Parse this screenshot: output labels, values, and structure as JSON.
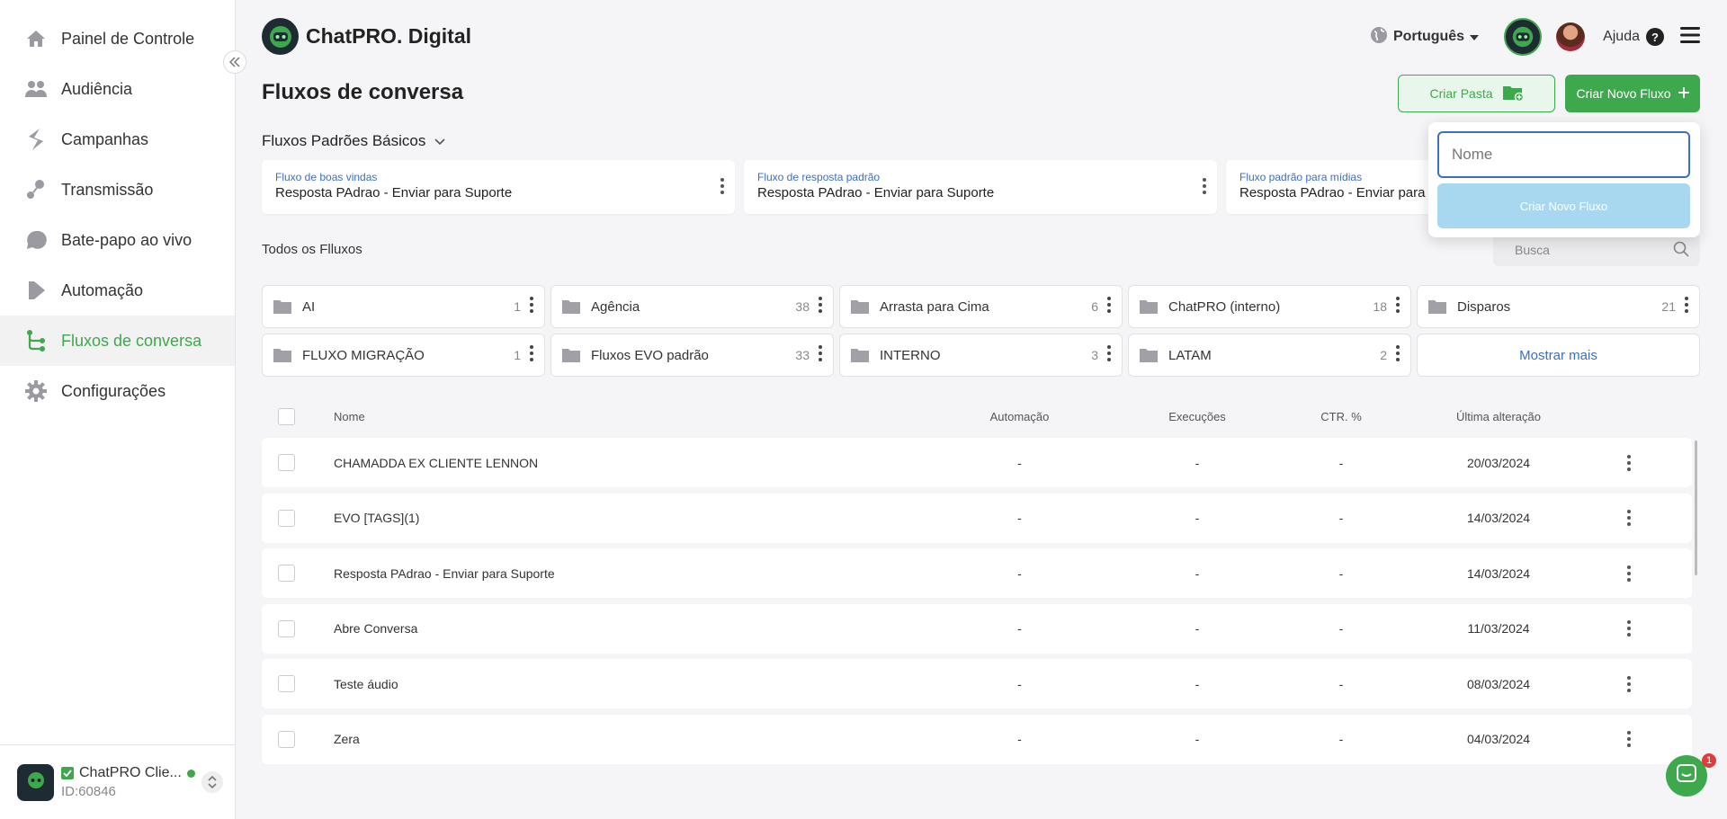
{
  "sidebar": {
    "items": [
      {
        "label": "Painel de Controle",
        "icon": "home-icon"
      },
      {
        "label": "Audiência",
        "icon": "people-icon"
      },
      {
        "label": "Campanhas",
        "icon": "campaign-icon"
      },
      {
        "label": "Transmissão",
        "icon": "broadcast-icon"
      },
      {
        "label": "Bate-papo ao vivo",
        "icon": "chat-icon"
      },
      {
        "label": "Automação",
        "icon": "automation-icon"
      },
      {
        "label": "Fluxos de conversa",
        "icon": "flow-icon",
        "active": true
      },
      {
        "label": "Configurações",
        "icon": "gear-icon"
      }
    ],
    "account": {
      "name": "ChatPRO Clie...",
      "id": "ID:60846"
    }
  },
  "header": {
    "brand": "ChatPRO. Digital",
    "language": "Português",
    "help": "Ajuda"
  },
  "page": {
    "title": "Fluxos de conversa",
    "create_folder": "Criar Pasta",
    "create_flow": "Criar Novo Fluxo"
  },
  "basic": {
    "section_title": "Fluxos Padrões Básicos",
    "cards": [
      {
        "caption": "Fluxo de boas vindas",
        "value": "Resposta PAdrao - Enviar para Suporte"
      },
      {
        "caption": "Fluxo de resposta padrão",
        "value": "Resposta PAdrao - Enviar para Suporte"
      },
      {
        "caption": "Fluxo padrão para mídias",
        "value": "Resposta PAdrao - Enviar para Suporte"
      }
    ]
  },
  "all": {
    "title": "Todos os Flluxos",
    "search_placeholder": "Busca"
  },
  "folders": [
    {
      "name": "AI",
      "count": "1"
    },
    {
      "name": "Agência",
      "count": "38"
    },
    {
      "name": "Arrasta para Cima",
      "count": "6"
    },
    {
      "name": "ChatPRO (interno)",
      "count": "18"
    },
    {
      "name": "Disparos",
      "count": "21"
    },
    {
      "name": "FLUXO MIGRAÇÃO",
      "count": "1"
    },
    {
      "name": "Fluxos EVO padrão",
      "count": "33"
    },
    {
      "name": "INTERNO",
      "count": "3"
    },
    {
      "name": "LATAM",
      "count": "2"
    }
  ],
  "show_more": "Mostrar mais",
  "table": {
    "headers": {
      "name": "Nome",
      "automation": "Automação",
      "executions": "Execuções",
      "ctr": "CTR. %",
      "last_change": "Última alteração"
    },
    "rows": [
      {
        "name": "CHAMADDA EX CLIENTE LENNON",
        "automation": "-",
        "executions": "-",
        "ctr": "-",
        "date": "20/03/2024"
      },
      {
        "name": "EVO [TAGS](1)",
        "automation": "-",
        "executions": "-",
        "ctr": "-",
        "date": "14/03/2024"
      },
      {
        "name": "Resposta PAdrao - Enviar para Suporte",
        "automation": "-",
        "executions": "-",
        "ctr": "-",
        "date": "14/03/2024"
      },
      {
        "name": "Abre Conversa",
        "automation": "-",
        "executions": "-",
        "ctr": "-",
        "date": "11/03/2024"
      },
      {
        "name": "Teste áudio",
        "automation": "-",
        "executions": "-",
        "ctr": "-",
        "date": "08/03/2024"
      },
      {
        "name": "Zera",
        "automation": "-",
        "executions": "-",
        "ctr": "-",
        "date": "04/03/2024"
      }
    ]
  },
  "popover": {
    "name_placeholder": "Nome",
    "create_label": "Criar Novo Fluxo"
  },
  "chat": {
    "badge": "1"
  },
  "colors": {
    "accent": "#3ea84c",
    "link": "#3b6fc4",
    "dark": "#1f2b33"
  }
}
